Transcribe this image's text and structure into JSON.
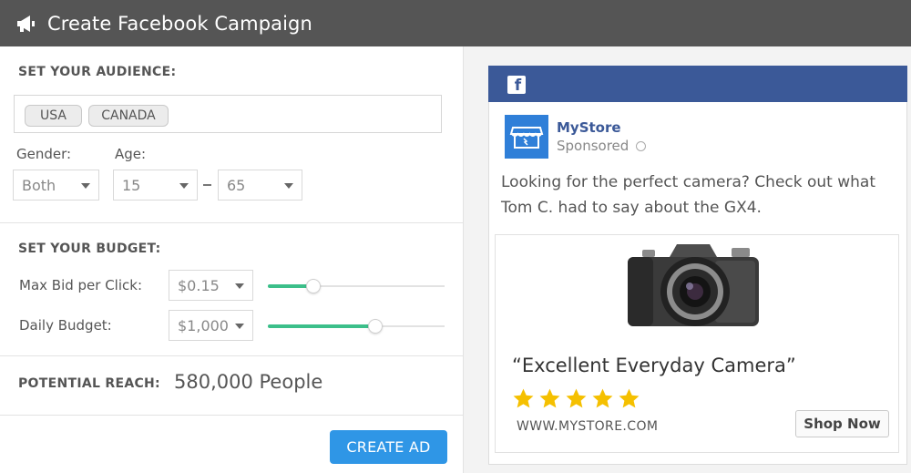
{
  "header": {
    "title": "Create Facebook Campaign",
    "icon": "megaphone-icon"
  },
  "audience": {
    "section_label": "SET YOUR AUDIENCE:",
    "tags": [
      "USA",
      "CANADA"
    ],
    "gender_label": "Gender:",
    "gender_value": "Both",
    "age_label": "Age:",
    "age_min": "15",
    "age_max": "65"
  },
  "budget": {
    "section_label": "SET YOUR BUDGET:",
    "max_bid_label": "Max Bid per Click:",
    "max_bid_value": "$0.15",
    "max_bid_slider_fraction": 0.26,
    "daily_label": "Daily Budget:",
    "daily_value": "$1,000",
    "daily_slider_fraction": 0.61
  },
  "reach": {
    "label": "POTENTIAL REACH:",
    "value": "580,000 People"
  },
  "actions": {
    "create_label": "CREATE AD"
  },
  "preview": {
    "brand_icon": "facebook-icon",
    "store_name": "MyStore",
    "sponsored": "Sponsored",
    "post_text": "Looking for the perfect camera? Check out what Tom C. had to say about the GX4.",
    "headline": "“Excellent Everyday Camera”",
    "rating": 5,
    "url": "WWW.MYSTORE.COM",
    "cta_label": "Shop Now"
  },
  "colors": {
    "header_bg": "#555555",
    "facebook_blue": "#3b5998",
    "slider_green": "#3cbf8a",
    "button_blue": "#2f96e6",
    "star_yellow": "#f5c000"
  }
}
